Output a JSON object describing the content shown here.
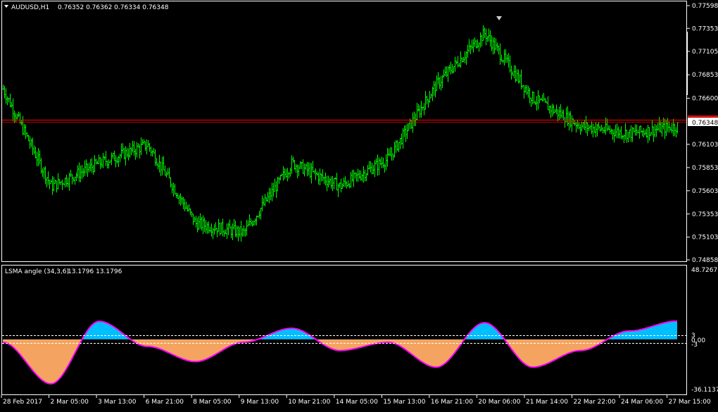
{
  "main_header": {
    "symbol_timeframe": "AUDUSD,H1",
    "ohlc": "0.76352 0.76362 0.76334 0.76348"
  },
  "indicator_header": {
    "name": "LSMA angle (34,3,6)",
    "values": "13.1796 13.1796"
  },
  "current_price": "0.76348",
  "price_axis": [
    "0.77598",
    "0.77353",
    "0.77105",
    "0.76853",
    "0.76600",
    "0.76348",
    "0.76103",
    "0.75853",
    "0.75603",
    "0.75353",
    "0.75103",
    "0.74858"
  ],
  "indicator_axis": {
    "max": "48.7267",
    "level_upper": "3",
    "level_zero": "0.00",
    "level_lower": "-3",
    "min": "-36.1137"
  },
  "time_axis": [
    "28 Feb 2017",
    "2 Mar 05:00",
    "3 Mar 13:00",
    "6 Mar 21:00",
    "8 Mar 05:00",
    "9 Mar 13:00",
    "10 Mar 21:00",
    "14 Mar 05:00",
    "15 Mar 13:00",
    "16 Mar 21:00",
    "20 Mar 06:00",
    "21 Mar 14:00",
    "22 Mar 22:00",
    "24 Mar 06:00",
    "27 Mar 15:00"
  ],
  "colors": {
    "background": "#000000",
    "frame": "#ffffff",
    "bars": "#00ff00",
    "price_line": "#ff0000",
    "positive_fill": "#00bfff",
    "negative_fill": "#f4a460",
    "indicator_line": "#ff00ff"
  },
  "chart_data": [
    {
      "type": "line",
      "title": "AUDUSD,H1",
      "ylim": [
        0.74858,
        0.77598
      ],
      "x": [
        "28 Feb 2017",
        "2 Mar 05:00",
        "3 Mar 13:00",
        "6 Mar 21:00",
        "8 Mar 05:00",
        "9 Mar 13:00",
        "10 Mar 21:00",
        "14 Mar 05:00",
        "15 Mar 13:00",
        "16 Mar 21:00",
        "20 Mar 06:00",
        "21 Mar 14:00",
        "22 Mar 22:00",
        "24 Mar 06:00",
        "27 Mar 15:00"
      ],
      "series": [
        {
          "name": "AUDUSD,H1",
          "values": [
            0.767,
            0.7565,
            0.759,
            0.761,
            0.7525,
            0.7515,
            0.759,
            0.7565,
            0.7595,
            0.7675,
            0.773,
            0.766,
            0.763,
            0.7622,
            0.763
          ]
        }
      ]
    },
    {
      "type": "area",
      "title": "LSMA angle (34,3,6)",
      "ylim": [
        -36.1137,
        48.7267
      ],
      "x": [
        "28 Feb 2017",
        "2 Mar 05:00",
        "3 Mar 13:00",
        "6 Mar 21:00",
        "8 Mar 05:00",
        "9 Mar 13:00",
        "10 Mar 21:00",
        "14 Mar 05:00",
        "15 Mar 13:00",
        "16 Mar 21:00",
        "20 Mar 06:00",
        "21 Mar 14:00",
        "22 Mar 22:00",
        "24 Mar 06:00",
        "27 Mar 15:00"
      ],
      "series": [
        {
          "name": "LSMA angle (34,3,6)",
          "values": [
            -2,
            -32,
            13,
            -5,
            -16,
            -2,
            8,
            -8,
            -2,
            -20,
            12,
            -20,
            -8,
            6,
            13.18
          ]
        }
      ]
    }
  ]
}
